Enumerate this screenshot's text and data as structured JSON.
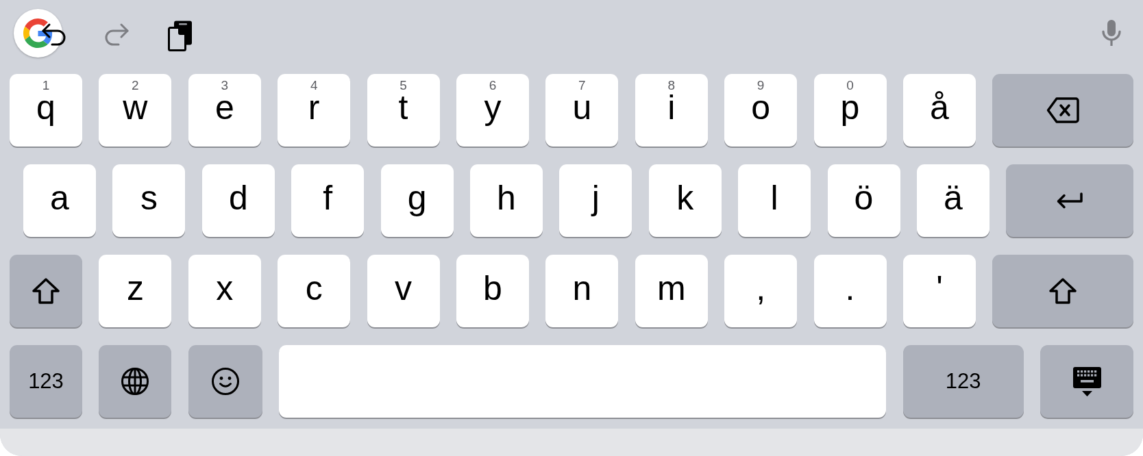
{
  "toolbar": {
    "left": [
      {
        "kind": "logo",
        "disabled": false
      },
      {
        "kind": "undo",
        "disabled": false
      },
      {
        "kind": "redo",
        "disabled": true
      },
      {
        "kind": "clipboard",
        "disabled": false
      }
    ],
    "right": [
      {
        "kind": "mic"
      }
    ]
  },
  "rows": [
    {
      "keys": [
        {
          "kind": "char",
          "label": "q",
          "hint": "1"
        },
        {
          "kind": "char",
          "label": "w",
          "hint": "2"
        },
        {
          "kind": "char",
          "label": "e",
          "hint": "3"
        },
        {
          "kind": "char",
          "label": "r",
          "hint": "4"
        },
        {
          "kind": "char",
          "label": "t",
          "hint": "5"
        },
        {
          "kind": "char",
          "label": "y",
          "hint": "6"
        },
        {
          "kind": "char",
          "label": "u",
          "hint": "7"
        },
        {
          "kind": "char",
          "label": "i",
          "hint": "8"
        },
        {
          "kind": "char",
          "label": "o",
          "hint": "9"
        },
        {
          "kind": "char",
          "label": "p",
          "hint": "0"
        },
        {
          "kind": "char",
          "label": "å"
        },
        {
          "kind": "backspace"
        }
      ]
    },
    {
      "keys": [
        {
          "kind": "char",
          "label": "a"
        },
        {
          "kind": "char",
          "label": "s"
        },
        {
          "kind": "char",
          "label": "d"
        },
        {
          "kind": "char",
          "label": "f"
        },
        {
          "kind": "char",
          "label": "g"
        },
        {
          "kind": "char",
          "label": "h"
        },
        {
          "kind": "char",
          "label": "j"
        },
        {
          "kind": "char",
          "label": "k"
        },
        {
          "kind": "char",
          "label": "l"
        },
        {
          "kind": "char",
          "label": "ö"
        },
        {
          "kind": "char",
          "label": "ä"
        },
        {
          "kind": "return"
        }
      ]
    },
    {
      "keys": [
        {
          "kind": "shift",
          "on": false
        },
        {
          "kind": "char",
          "label": "z"
        },
        {
          "kind": "char",
          "label": "x"
        },
        {
          "kind": "char",
          "label": "c"
        },
        {
          "kind": "char",
          "label": "v"
        },
        {
          "kind": "char",
          "label": "b"
        },
        {
          "kind": "char",
          "label": "n"
        },
        {
          "kind": "char",
          "label": "m"
        },
        {
          "kind": "char",
          "label": ","
        },
        {
          "kind": "char",
          "label": "."
        },
        {
          "kind": "char",
          "label": "'"
        },
        {
          "kind": "shift",
          "on": false
        }
      ]
    },
    {
      "keys": [
        {
          "kind": "symbols",
          "label": "123"
        },
        {
          "kind": "globe"
        },
        {
          "kind": "emoji"
        },
        {
          "kind": "space"
        },
        {
          "kind": "symbols",
          "label": "123"
        },
        {
          "kind": "hide"
        }
      ]
    }
  ]
}
